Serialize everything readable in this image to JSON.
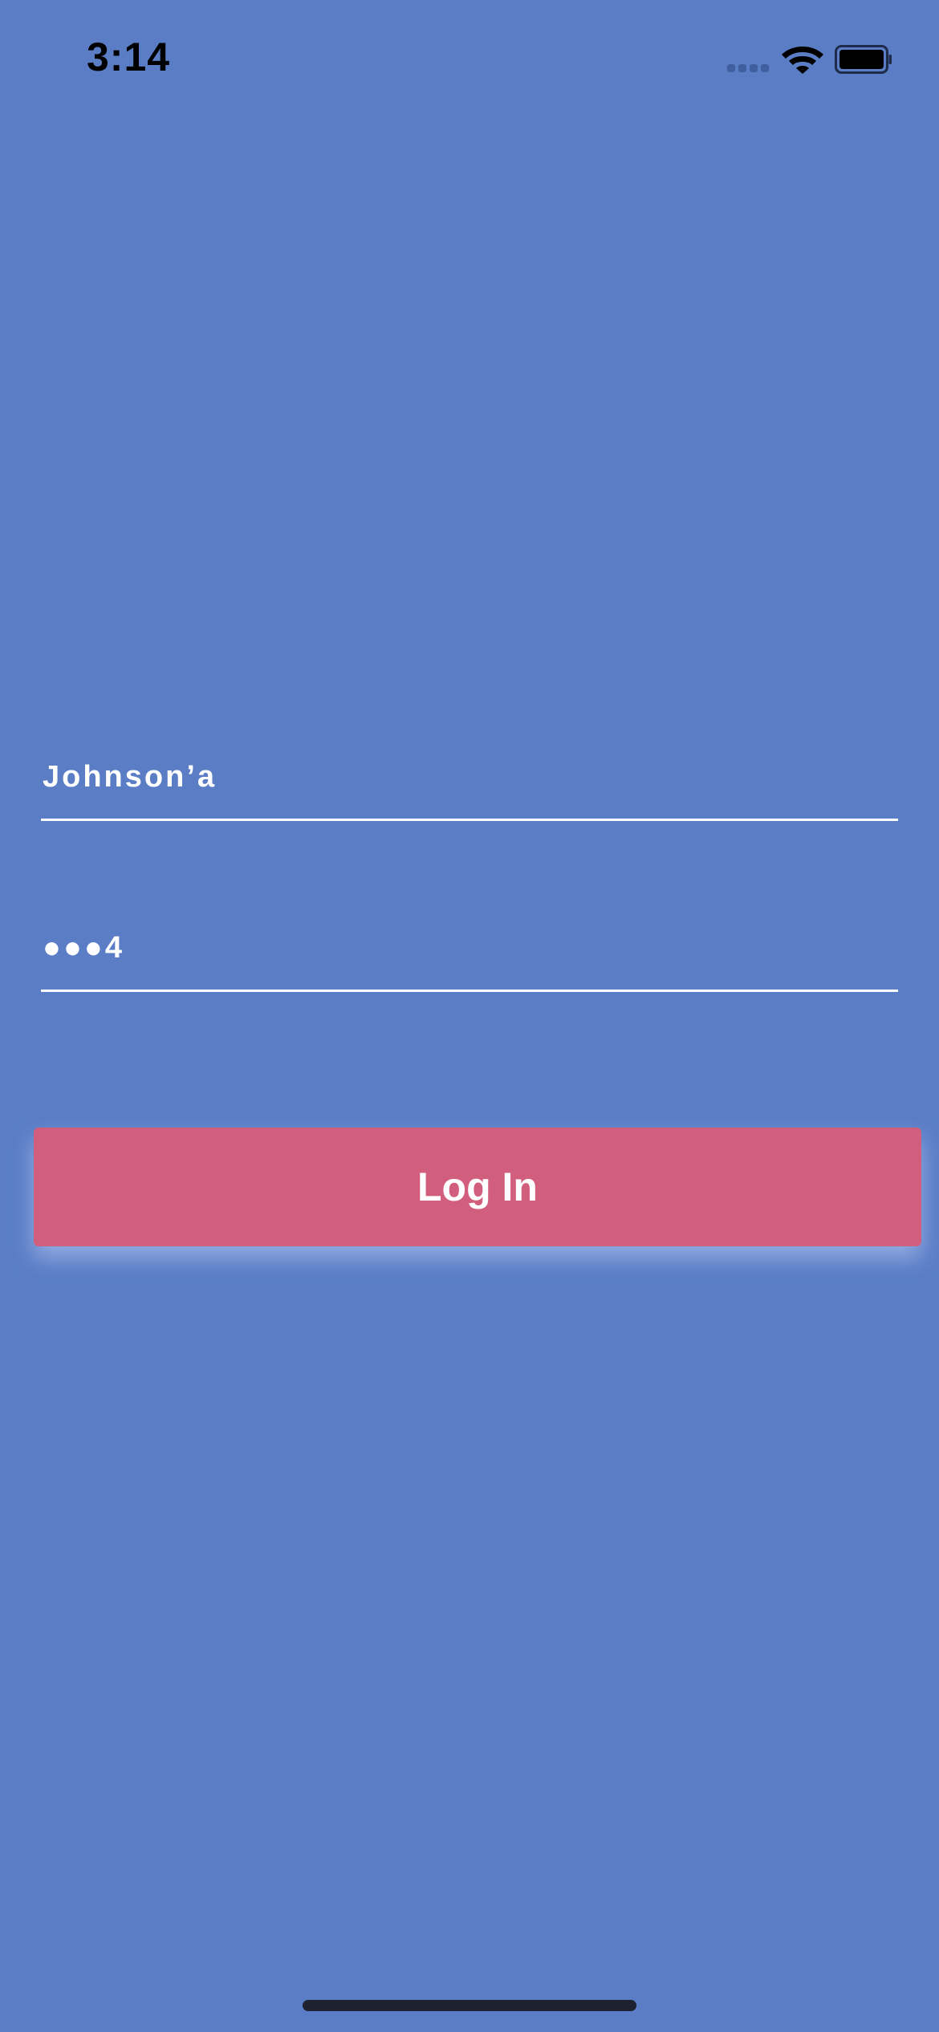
{
  "status_bar": {
    "time": "3:14",
    "signal_icon": "cellular-signal-icon",
    "wifi_icon": "wifi-icon",
    "battery_icon": "battery-icon"
  },
  "login_form": {
    "username_value": "Johnson’a",
    "password_value": "●●●4",
    "login_label": "Log In"
  },
  "colors": {
    "background": "#5a7dc6",
    "button": "#d15e7c",
    "text": "#ffffff"
  }
}
